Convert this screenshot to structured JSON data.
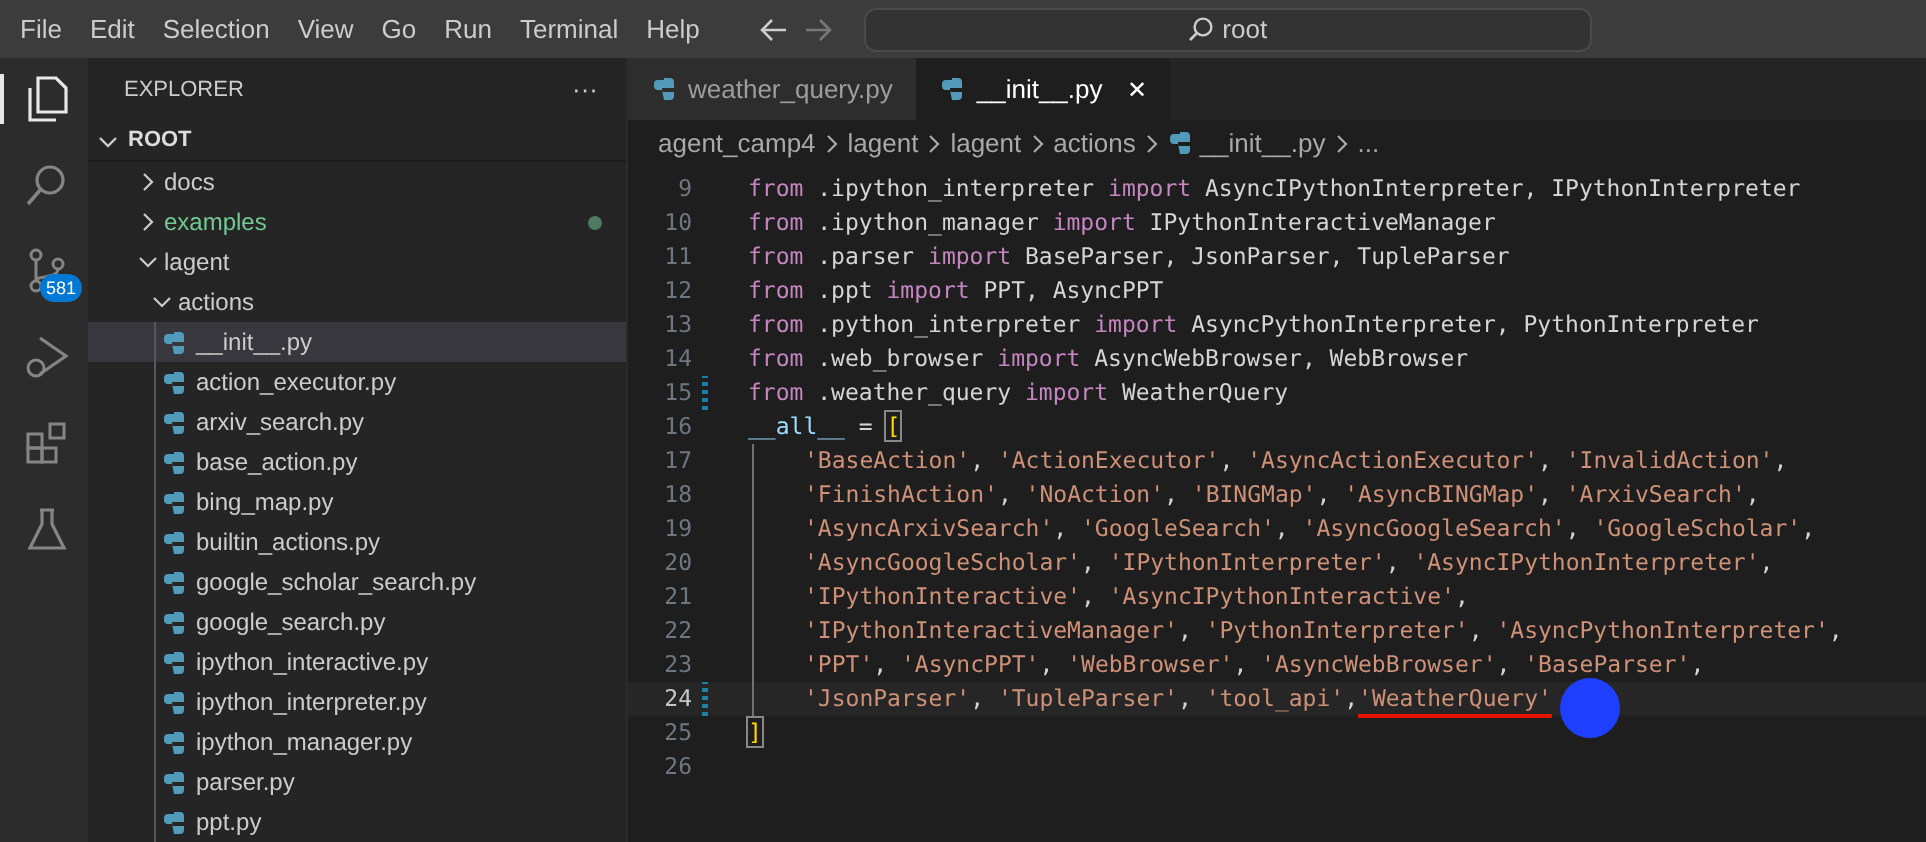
{
  "menu": [
    "File",
    "Edit",
    "Selection",
    "View",
    "Go",
    "Run",
    "Terminal",
    "Help"
  ],
  "command_center": {
    "placeholder": "root"
  },
  "activity_bar": [
    {
      "kind": "files",
      "selected": true
    },
    {
      "kind": "search",
      "selected": false
    },
    {
      "kind": "source-control",
      "selected": false,
      "badge": "581"
    },
    {
      "kind": "debug",
      "selected": false
    },
    {
      "kind": "extensions",
      "selected": false
    },
    {
      "kind": "testing",
      "selected": false
    }
  ],
  "explorer": {
    "title": "EXPLORER",
    "more": "···",
    "root": "ROOT",
    "tree": [
      {
        "label": "docs",
        "kind": "folder",
        "expanded": false,
        "selected": false,
        "modified": false
      },
      {
        "label": "examples",
        "kind": "folder",
        "expanded": false,
        "selected": false,
        "modified": true
      },
      {
        "label": "lagent",
        "kind": "folder",
        "expanded": true,
        "selected": false,
        "modified": false,
        "children": [
          {
            "label": "actions",
            "kind": "folder",
            "expanded": true,
            "selected": false,
            "modified": false,
            "children": [
              {
                "label": "__init__.py",
                "kind": "python",
                "selected": true,
                "modified": false
              },
              {
                "label": "action_executor.py",
                "kind": "python",
                "selected": false,
                "modified": false
              },
              {
                "label": "arxiv_search.py",
                "kind": "python",
                "selected": false,
                "modified": false
              },
              {
                "label": "base_action.py",
                "kind": "python",
                "selected": false,
                "modified": false
              },
              {
                "label": "bing_map.py",
                "kind": "python",
                "selected": false,
                "modified": false
              },
              {
                "label": "builtin_actions.py",
                "kind": "python",
                "selected": false,
                "modified": false
              },
              {
                "label": "google_scholar_search.py",
                "kind": "python",
                "selected": false,
                "modified": false
              },
              {
                "label": "google_search.py",
                "kind": "python",
                "selected": false,
                "modified": false
              },
              {
                "label": "ipython_interactive.py",
                "kind": "python",
                "selected": false,
                "modified": false
              },
              {
                "label": "ipython_interpreter.py",
                "kind": "python",
                "selected": false,
                "modified": false
              },
              {
                "label": "ipython_manager.py",
                "kind": "python",
                "selected": false,
                "modified": false
              },
              {
                "label": "parser.py",
                "kind": "python",
                "selected": false,
                "modified": false
              },
              {
                "label": "ppt.py",
                "kind": "python",
                "selected": false,
                "modified": false
              }
            ]
          }
        ]
      }
    ]
  },
  "tabs": [
    {
      "label": "weather_query.py",
      "selected": false
    },
    {
      "label": "__init__.py",
      "selected": true,
      "close": "✕"
    }
  ],
  "breadcrumb": [
    "agent_camp4",
    "lagent",
    "lagent",
    "actions",
    "__init__.py",
    "..."
  ],
  "editor": {
    "lines": [
      {
        "number": "9",
        "current": false,
        "changed": false,
        "tokens": [
          {
            "kind": "keyword",
            "text": "from"
          },
          {
            "kind": "plain",
            "text": " .ipython_interpreter "
          },
          {
            "kind": "keyword",
            "text": "import"
          },
          {
            "kind": "plain",
            "text": " AsyncIPythonInterpreter, IPythonInterpreter"
          }
        ]
      },
      {
        "number": "10",
        "current": false,
        "changed": false,
        "tokens": [
          {
            "kind": "keyword",
            "text": "from"
          },
          {
            "kind": "plain",
            "text": " .ipython_manager "
          },
          {
            "kind": "keyword",
            "text": "import"
          },
          {
            "kind": "plain",
            "text": " IPythonInteractiveManager"
          }
        ]
      },
      {
        "number": "11",
        "current": false,
        "changed": false,
        "tokens": [
          {
            "kind": "keyword",
            "text": "from"
          },
          {
            "kind": "plain",
            "text": " .parser "
          },
          {
            "kind": "keyword",
            "text": "import"
          },
          {
            "kind": "plain",
            "text": " BaseParser, JsonParser, TupleParser"
          }
        ]
      },
      {
        "number": "12",
        "current": false,
        "changed": false,
        "tokens": [
          {
            "kind": "keyword",
            "text": "from"
          },
          {
            "kind": "plain",
            "text": " .ppt "
          },
          {
            "kind": "keyword",
            "text": "import"
          },
          {
            "kind": "plain",
            "text": " PPT, AsyncPPT"
          }
        ]
      },
      {
        "number": "13",
        "current": false,
        "changed": false,
        "tokens": [
          {
            "kind": "keyword",
            "text": "from"
          },
          {
            "kind": "plain",
            "text": " .python_interpreter "
          },
          {
            "kind": "keyword",
            "text": "import"
          },
          {
            "kind": "plain",
            "text": " AsyncPythonInterpreter, PythonInterpreter"
          }
        ]
      },
      {
        "number": "14",
        "current": false,
        "changed": false,
        "tokens": [
          {
            "kind": "keyword",
            "text": "from"
          },
          {
            "kind": "plain",
            "text": " .web_browser "
          },
          {
            "kind": "keyword",
            "text": "import"
          },
          {
            "kind": "plain",
            "text": " AsyncWebBrowser, WebBrowser"
          }
        ]
      },
      {
        "number": "15",
        "current": false,
        "changed": true,
        "tokens": [
          {
            "kind": "keyword",
            "text": "from"
          },
          {
            "kind": "plain",
            "text": " .weather_query "
          },
          {
            "kind": "keyword",
            "text": "import"
          },
          {
            "kind": "plain",
            "text": " WeatherQuery"
          }
        ]
      },
      {
        "number": "16",
        "current": false,
        "changed": false,
        "tokens": [
          {
            "kind": "variable",
            "text": "__all__"
          },
          {
            "kind": "plain",
            "text": " = "
          },
          {
            "kind": "bracket",
            "text": "["
          }
        ]
      },
      {
        "number": "17",
        "current": false,
        "changed": false,
        "indent": true,
        "tokens": [
          {
            "kind": "string",
            "text": "'BaseAction'"
          },
          {
            "kind": "plain",
            "text": ", "
          },
          {
            "kind": "string",
            "text": "'ActionExecutor'"
          },
          {
            "kind": "plain",
            "text": ", "
          },
          {
            "kind": "string",
            "text": "'AsyncActionExecutor'"
          },
          {
            "kind": "plain",
            "text": ", "
          },
          {
            "kind": "string",
            "text": "'InvalidAction'"
          },
          {
            "kind": "plain",
            "text": ","
          }
        ]
      },
      {
        "number": "18",
        "current": false,
        "changed": false,
        "indent": true,
        "tokens": [
          {
            "kind": "string",
            "text": "'FinishAction'"
          },
          {
            "kind": "plain",
            "text": ", "
          },
          {
            "kind": "string",
            "text": "'NoAction'"
          },
          {
            "kind": "plain",
            "text": ", "
          },
          {
            "kind": "string",
            "text": "'BINGMap'"
          },
          {
            "kind": "plain",
            "text": ", "
          },
          {
            "kind": "string",
            "text": "'AsyncBINGMap'"
          },
          {
            "kind": "plain",
            "text": ", "
          },
          {
            "kind": "string",
            "text": "'ArxivSearch'"
          },
          {
            "kind": "plain",
            "text": ","
          }
        ]
      },
      {
        "number": "19",
        "current": false,
        "changed": false,
        "indent": true,
        "tokens": [
          {
            "kind": "string",
            "text": "'AsyncArxivSearch'"
          },
          {
            "kind": "plain",
            "text": ", "
          },
          {
            "kind": "string",
            "text": "'GoogleSearch'"
          },
          {
            "kind": "plain",
            "text": ", "
          },
          {
            "kind": "string",
            "text": "'AsyncGoogleSearch'"
          },
          {
            "kind": "plain",
            "text": ", "
          },
          {
            "kind": "string",
            "text": "'GoogleScholar'"
          },
          {
            "kind": "plain",
            "text": ","
          }
        ]
      },
      {
        "number": "20",
        "current": false,
        "changed": false,
        "indent": true,
        "tokens": [
          {
            "kind": "string",
            "text": "'AsyncGoogleScholar'"
          },
          {
            "kind": "plain",
            "text": ", "
          },
          {
            "kind": "string",
            "text": "'IPythonInterpreter'"
          },
          {
            "kind": "plain",
            "text": ", "
          },
          {
            "kind": "string",
            "text": "'AsyncIPythonInterpreter'"
          },
          {
            "kind": "plain",
            "text": ","
          }
        ]
      },
      {
        "number": "21",
        "current": false,
        "changed": false,
        "indent": true,
        "tokens": [
          {
            "kind": "string",
            "text": "'IPythonInteractive'"
          },
          {
            "kind": "plain",
            "text": ", "
          },
          {
            "kind": "string",
            "text": "'AsyncIPythonInteractive'"
          },
          {
            "kind": "plain",
            "text": ","
          }
        ]
      },
      {
        "number": "22",
        "current": false,
        "changed": false,
        "indent": true,
        "tokens": [
          {
            "kind": "string",
            "text": "'IPythonInteractiveManager'"
          },
          {
            "kind": "plain",
            "text": ", "
          },
          {
            "kind": "string",
            "text": "'PythonInterpreter'"
          },
          {
            "kind": "plain",
            "text": ", "
          },
          {
            "kind": "string",
            "text": "'AsyncPythonInterpreter'"
          },
          {
            "kind": "plain",
            "text": ","
          }
        ]
      },
      {
        "number": "23",
        "current": false,
        "changed": false,
        "indent": true,
        "tokens": [
          {
            "kind": "string",
            "text": "'PPT'"
          },
          {
            "kind": "plain",
            "text": ", "
          },
          {
            "kind": "string",
            "text": "'AsyncPPT'"
          },
          {
            "kind": "plain",
            "text": ", "
          },
          {
            "kind": "string",
            "text": "'WebBrowser'"
          },
          {
            "kind": "plain",
            "text": ", "
          },
          {
            "kind": "string",
            "text": "'AsyncWebBrowser'"
          },
          {
            "kind": "plain",
            "text": ", "
          },
          {
            "kind": "string",
            "text": "'BaseParser'"
          },
          {
            "kind": "plain",
            "text": ","
          }
        ]
      },
      {
        "number": "24",
        "current": true,
        "changed": true,
        "indent": true,
        "tokens": [
          {
            "kind": "string",
            "text": "'JsonParser'"
          },
          {
            "kind": "plain",
            "text": ", "
          },
          {
            "kind": "string",
            "text": "'TupleParser'"
          },
          {
            "kind": "plain",
            "text": ", "
          },
          {
            "kind": "string",
            "text": "'tool_api'"
          },
          {
            "kind": "plain",
            "text": ","
          },
          {
            "kind": "error",
            "text": "'WeatherQuery'"
          }
        ]
      },
      {
        "number": "25",
        "current": false,
        "changed": false,
        "tokens": [
          {
            "kind": "bracket",
            "text": "]"
          }
        ]
      },
      {
        "number": "26",
        "current": false,
        "changed": false
      }
    ]
  }
}
